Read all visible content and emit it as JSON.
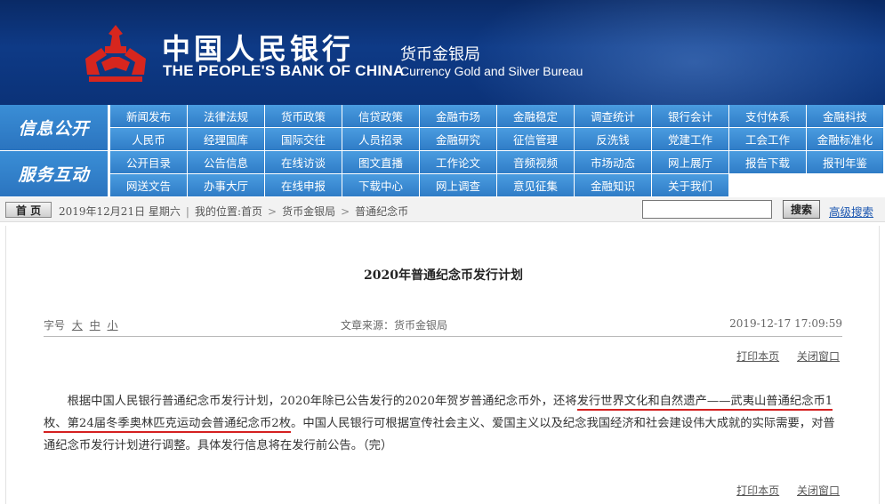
{
  "header": {
    "bank_name_cn": "中国人民银行",
    "bank_name_en": "THE PEOPLE'S BANK OF CHINA",
    "bureau_cn": "货币金银局",
    "bureau_en": "Currency Gold and Silver Bureau",
    "logo_icon": "pboc-emblem-icon",
    "logo_color": "#d7261e"
  },
  "nav": {
    "groups": [
      {
        "label": "信息公开",
        "rows": [
          [
            "新闻发布",
            "法律法规",
            "货币政策",
            "信贷政策",
            "金融市场",
            "金融稳定",
            "调查统计",
            "银行会计",
            "支付体系",
            "金融科技"
          ],
          [
            "人民币",
            "经理国库",
            "国际交往",
            "人员招录",
            "金融研究",
            "征信管理",
            "反洗钱",
            "党建工作",
            "工会工作",
            "金融标准化"
          ]
        ]
      },
      {
        "label": "服务互动",
        "rows": [
          [
            "公开目录",
            "公告信息",
            "在线访谈",
            "图文直播",
            "工作论文",
            "音频视频",
            "市场动态",
            "网上展厅",
            "报告下载",
            "报刊年鉴"
          ],
          [
            "网送文告",
            "办事大厅",
            "在线申报",
            "下载中心",
            "网上调查",
            "意见征集",
            "金融知识",
            "关于我们"
          ]
        ]
      }
    ]
  },
  "breadcrumb": {
    "home_label": "首 页",
    "date": "2019年12月21日 星期六",
    "location_label": "我的位置:",
    "items": [
      "首页",
      "货币金银局",
      "普通纪念币"
    ],
    "search_value": "",
    "search_button": "搜索",
    "advanced_search": "高级搜索"
  },
  "article": {
    "title": "2020年普通纪念币发行计划",
    "font_size_label": "字号",
    "font_sizes": [
      "大",
      "中",
      "小"
    ],
    "source": "文章来源：货币金银局",
    "datetime": "2019-12-17  17:09:59",
    "print_label": "打印本页",
    "close_label": "关闭窗口",
    "body_part1": "根据中国人民银行普通纪念币发行计划，2020年除已公告发行的2020年贺岁普通纪念币外，还将",
    "body_highlight": "发行世界文化和自然遗产——武夷山普通纪念币1枚、第24届冬季奥林匹克运动会普通纪念币2枚",
    "body_part2": "。中国人民银行可根据宣传社会主义、爱国主义以及纪念我国经济和社会建设伟大成就的实际需要，对普通纪念币发行计划进行调整。具体发行信息将在发行前公告。（完）",
    "highlight_color": "#d42020"
  },
  "colors": {
    "header_bg": "#0e3a86",
    "nav_bg": "#2f7cc6",
    "link": "#1a56b0"
  }
}
